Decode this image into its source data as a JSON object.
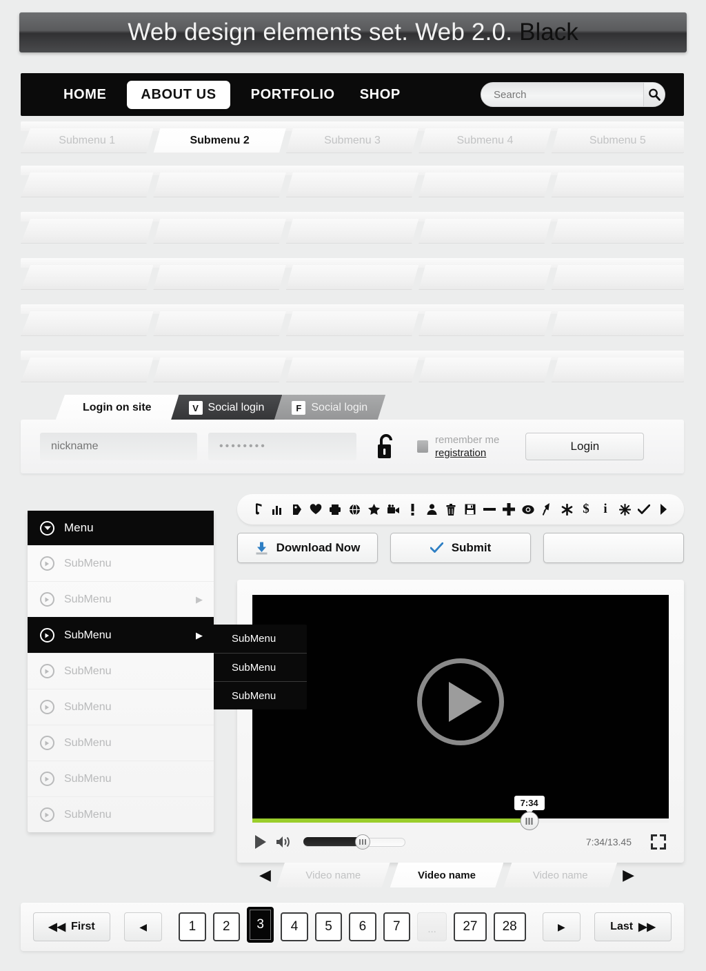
{
  "title": {
    "main": "Web design elements set. Web 2.0.",
    "accent": "Black"
  },
  "nav": {
    "items": [
      {
        "label": "HOME",
        "active": false
      },
      {
        "label": "ABOUT US",
        "active": true
      },
      {
        "label": "PORTFOLIO",
        "active": false
      },
      {
        "label": "SHOP",
        "active": false
      }
    ],
    "search": {
      "placeholder": "Search",
      "value": "",
      "icon": "search-icon"
    }
  },
  "submenu": {
    "items": [
      {
        "label": "Submenu 1",
        "active": false
      },
      {
        "label": "Submenu 2",
        "active": true
      },
      {
        "label": "Submenu 3",
        "active": false
      },
      {
        "label": "Submenu 4",
        "active": false
      },
      {
        "label": "Submenu 5",
        "active": false
      }
    ],
    "blank_strip_count": 5
  },
  "login": {
    "tabs": [
      {
        "label": "Login on site",
        "style": "active",
        "icon": null
      },
      {
        "label": "Social login",
        "style": "dark",
        "icon": "vk-icon",
        "glyph": "V"
      },
      {
        "label": "Social login",
        "style": "grey",
        "icon": "facebook-icon",
        "glyph": "F"
      }
    ],
    "nickname_placeholder": "nickname",
    "password_value": "••••••••",
    "lock_icon": "open-padlock-icon",
    "remember_label": "remember me",
    "registration_label": "registration",
    "login_button": "Login"
  },
  "toolbar": {
    "icons": [
      {
        "name": "music-note-icon",
        "glyph": "♪"
      },
      {
        "name": "bar-chart-icon",
        "glyph": "█"
      },
      {
        "name": "tag-icon",
        "glyph": "⚑"
      },
      {
        "name": "heart-icon",
        "glyph": "♥"
      },
      {
        "name": "printer-icon",
        "glyph": "⎙"
      },
      {
        "name": "globe-icon",
        "glyph": "⊕"
      },
      {
        "name": "star-icon",
        "glyph": "★"
      },
      {
        "name": "video-camera-icon",
        "glyph": "▶"
      },
      {
        "name": "exclamation-icon",
        "glyph": "!"
      },
      {
        "name": "user-icon",
        "glyph": "♟"
      },
      {
        "name": "trash-icon",
        "glyph": "☗"
      },
      {
        "name": "save-disk-icon",
        "glyph": "▤"
      },
      {
        "name": "minus-icon",
        "glyph": "—"
      },
      {
        "name": "plus-icon",
        "glyph": "✚"
      },
      {
        "name": "eye-icon",
        "glyph": "◉"
      },
      {
        "name": "pin-icon",
        "glyph": "⚑"
      },
      {
        "name": "asterisk-icon",
        "glyph": "✱"
      },
      {
        "name": "dollar-icon",
        "glyph": "$"
      },
      {
        "name": "info-icon",
        "glyph": "i"
      },
      {
        "name": "snowflake-icon",
        "glyph": "✻"
      },
      {
        "name": "check-icon",
        "glyph": "✓"
      },
      {
        "name": "arrow-right-icon",
        "glyph": "❯"
      }
    ]
  },
  "buttons": [
    {
      "label": "Download Now",
      "icon": "download-icon",
      "color": "#2e7fc4"
    },
    {
      "label": "Submit",
      "icon": "check-icon",
      "color": "#2e7fc4"
    },
    {
      "label": "",
      "icon": null,
      "color": ""
    }
  ],
  "menu": {
    "header": {
      "label": "Menu",
      "icon": "chevron-down-circle-icon"
    },
    "items": [
      {
        "label": "SubMenu",
        "arrow": false,
        "active": false
      },
      {
        "label": "SubMenu",
        "arrow": true,
        "active": false
      },
      {
        "label": "SubMenu",
        "arrow": true,
        "active": true
      },
      {
        "label": "SubMenu",
        "arrow": false,
        "active": false
      },
      {
        "label": "SubMenu",
        "arrow": false,
        "active": false
      },
      {
        "label": "SubMenu",
        "arrow": false,
        "active": false
      },
      {
        "label": "SubMenu",
        "arrow": false,
        "active": false
      },
      {
        "label": "SubMenu",
        "arrow": false,
        "active": false
      }
    ],
    "flyout": [
      {
        "label": "SubMenu"
      },
      {
        "label": "SubMenu"
      },
      {
        "label": "SubMenu"
      }
    ]
  },
  "player": {
    "play_icon": "play-circle-icon",
    "progress_percent": 66.5,
    "tooltip_time": "7:34",
    "time_display": "7:34/13.45",
    "volume_percent": 58,
    "volume_icon": "speaker-icon",
    "fullscreen_icon": "fullscreen-icon",
    "progress_color": "#9ace2b",
    "tabs": [
      {
        "label": "Video name",
        "active": false
      },
      {
        "label": "Video name",
        "active": true
      },
      {
        "label": "Video name",
        "active": false
      }
    ],
    "prev_icon": "caret-left-icon",
    "next_icon": "caret-right-icon"
  },
  "pagination": {
    "first_label": "First",
    "last_label": "Last",
    "prev_icon": "caret-left-icon",
    "next_icon": "caret-right-icon",
    "first_icon": "double-caret-left-icon",
    "last_icon": "double-caret-right-icon",
    "pages": [
      {
        "label": "1",
        "active": false,
        "type": "num"
      },
      {
        "label": "2",
        "active": false,
        "type": "num"
      },
      {
        "label": "3",
        "active": true,
        "type": "num"
      },
      {
        "label": "4",
        "active": false,
        "type": "num"
      },
      {
        "label": "5",
        "active": false,
        "type": "num"
      },
      {
        "label": "6",
        "active": false,
        "type": "num"
      },
      {
        "label": "7",
        "active": false,
        "type": "num"
      },
      {
        "label": "...",
        "active": false,
        "type": "dots"
      },
      {
        "label": "27",
        "active": false,
        "type": "num"
      },
      {
        "label": "28",
        "active": false,
        "type": "num"
      }
    ]
  }
}
